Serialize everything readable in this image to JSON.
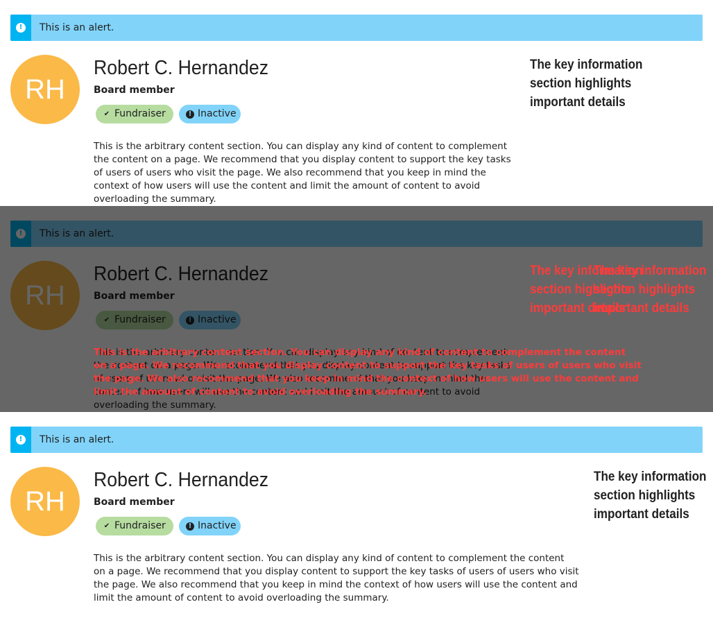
{
  "alert": {
    "text": "This is an alert.",
    "icon": "exclamation-circle-icon"
  },
  "person": {
    "initials": "RH",
    "name": "Robert C. Hernandez",
    "role": "Board member",
    "tags": [
      {
        "label": "Fundraiser",
        "icon": "check-icon",
        "color": "#b6dca0"
      },
      {
        "label": "Inactive",
        "icon": "exclamation-circle-icon",
        "color": "#81d3f9"
      }
    ]
  },
  "content": {
    "lines_narrow": [
      "This is the arbitrary content section. You can display any kind of content to complement",
      "the content on a page. We recommend that you display content to support the key tasks",
      "of users of users who visit the page. We also recommend that you keep in mind the",
      "context of how users will use the content and limit the amount of content to avoid",
      "overloading the summary."
    ],
    "lines_wide": [
      "This is the arbitrary content section. You can display any kind of content to complement the content",
      "on a page. We recommend that you display content to support the key tasks of users of users who visit",
      "the page. We also recommend that you keep in mind the context of how users will use the content and",
      "limit the amount of content to avoid overloading the summary."
    ]
  },
  "key_info": {
    "lines": [
      "The key information",
      "section highlights",
      "important details"
    ]
  },
  "colors": {
    "alert_bg": "#81d3f9",
    "alert_bar": "#00b4f1",
    "avatar": "#fbb948",
    "overlay_red": "#ff3b3b",
    "overlay_orange": "#e89a1a"
  }
}
